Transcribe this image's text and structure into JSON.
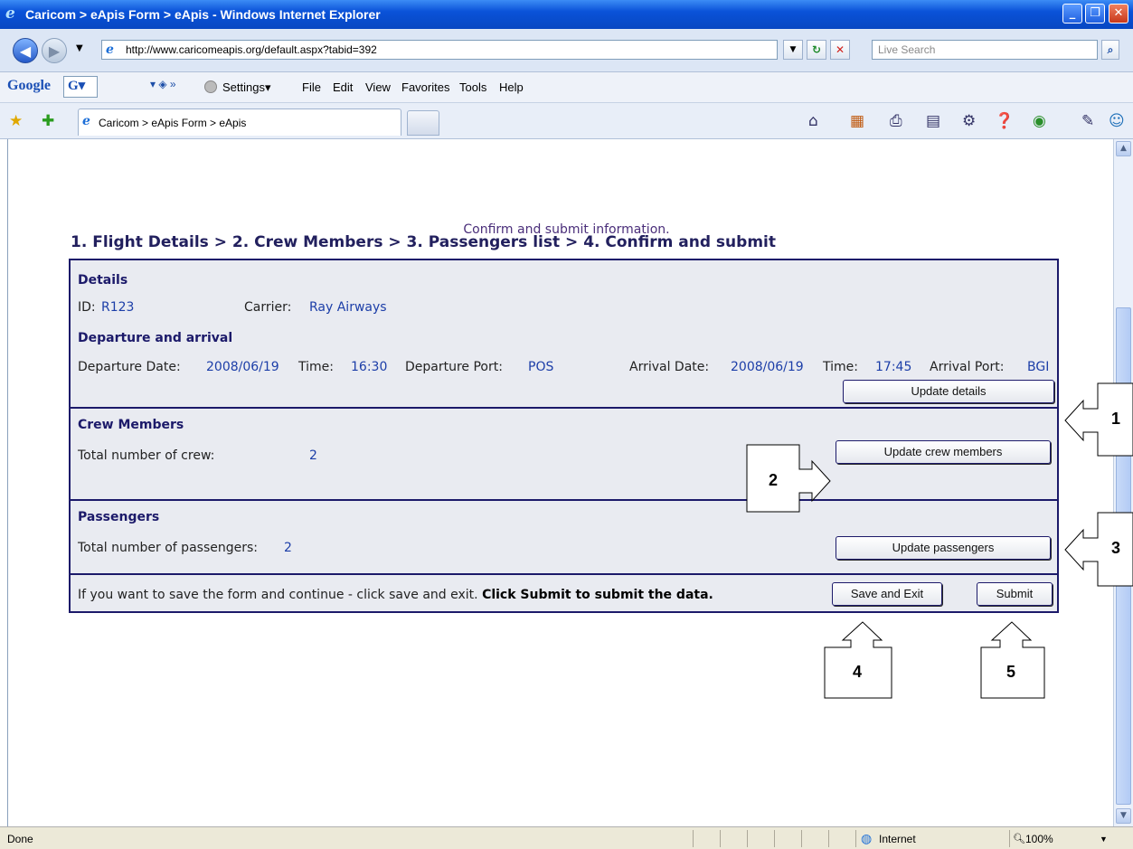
{
  "window": {
    "title": "Caricom > eApis Form > eApis - Windows Internet Explorer",
    "minimize": "_",
    "maximize": "❐",
    "close": "✕"
  },
  "address_bar": {
    "url": "http://www.caricomeapis.org/default.aspx?tabid=392",
    "search_placeholder": "Live Search"
  },
  "google_toolbar": {
    "brand": "Google",
    "settings_label": "Settings▾",
    "menu": [
      "File",
      "Edit",
      "View",
      "Favorites",
      "Tools",
      "Help"
    ]
  },
  "tab": {
    "label": "Caricom > eApis Form > eApis"
  },
  "page": {
    "steps": "1. Flight Details > 2. Crew Members > 3. Passengers list > 4. Confirm and submit",
    "subtitle": "Confirm and submit information.",
    "details": {
      "heading": "Details",
      "id_label": "ID:",
      "id_value": "R123",
      "carrier_label": "Carrier:",
      "carrier_value": "Ray Airways",
      "dep_arr_heading": "Departure and arrival",
      "departure_date_label": "Departure Date:",
      "departure_date": "2008/06/19",
      "time_label": "Time:",
      "departure_time": "16:30",
      "departure_port_label": "Departure Port:",
      "departure_port": "POS",
      "arrival_date_label": "Arrival Date:",
      "arrival_date": "2008/06/19",
      "arrival_time": "17:45",
      "arrival_port_label": "Arrival Port:",
      "arrival_port": "BGI",
      "update_button": "Update details"
    },
    "crew": {
      "heading": "Crew Members",
      "total_label": "Total number of crew:",
      "total_value": "2",
      "update_button": "Update crew members"
    },
    "passengers": {
      "heading": "Passengers",
      "total_label": "Total number of passengers:",
      "total_value": "2",
      "update_button": "Update passengers"
    },
    "footer": {
      "text": "If you want to save the form and continue - click save and exit.",
      "bold_text": "Click Submit to submit the data.",
      "save_button": "Save and Exit",
      "submit_button": "Submit"
    }
  },
  "callouts": [
    "1",
    "2",
    "3",
    "4",
    "5"
  ],
  "status_bar": {
    "left": "Done",
    "zone": "Internet",
    "zoom": "100%"
  }
}
